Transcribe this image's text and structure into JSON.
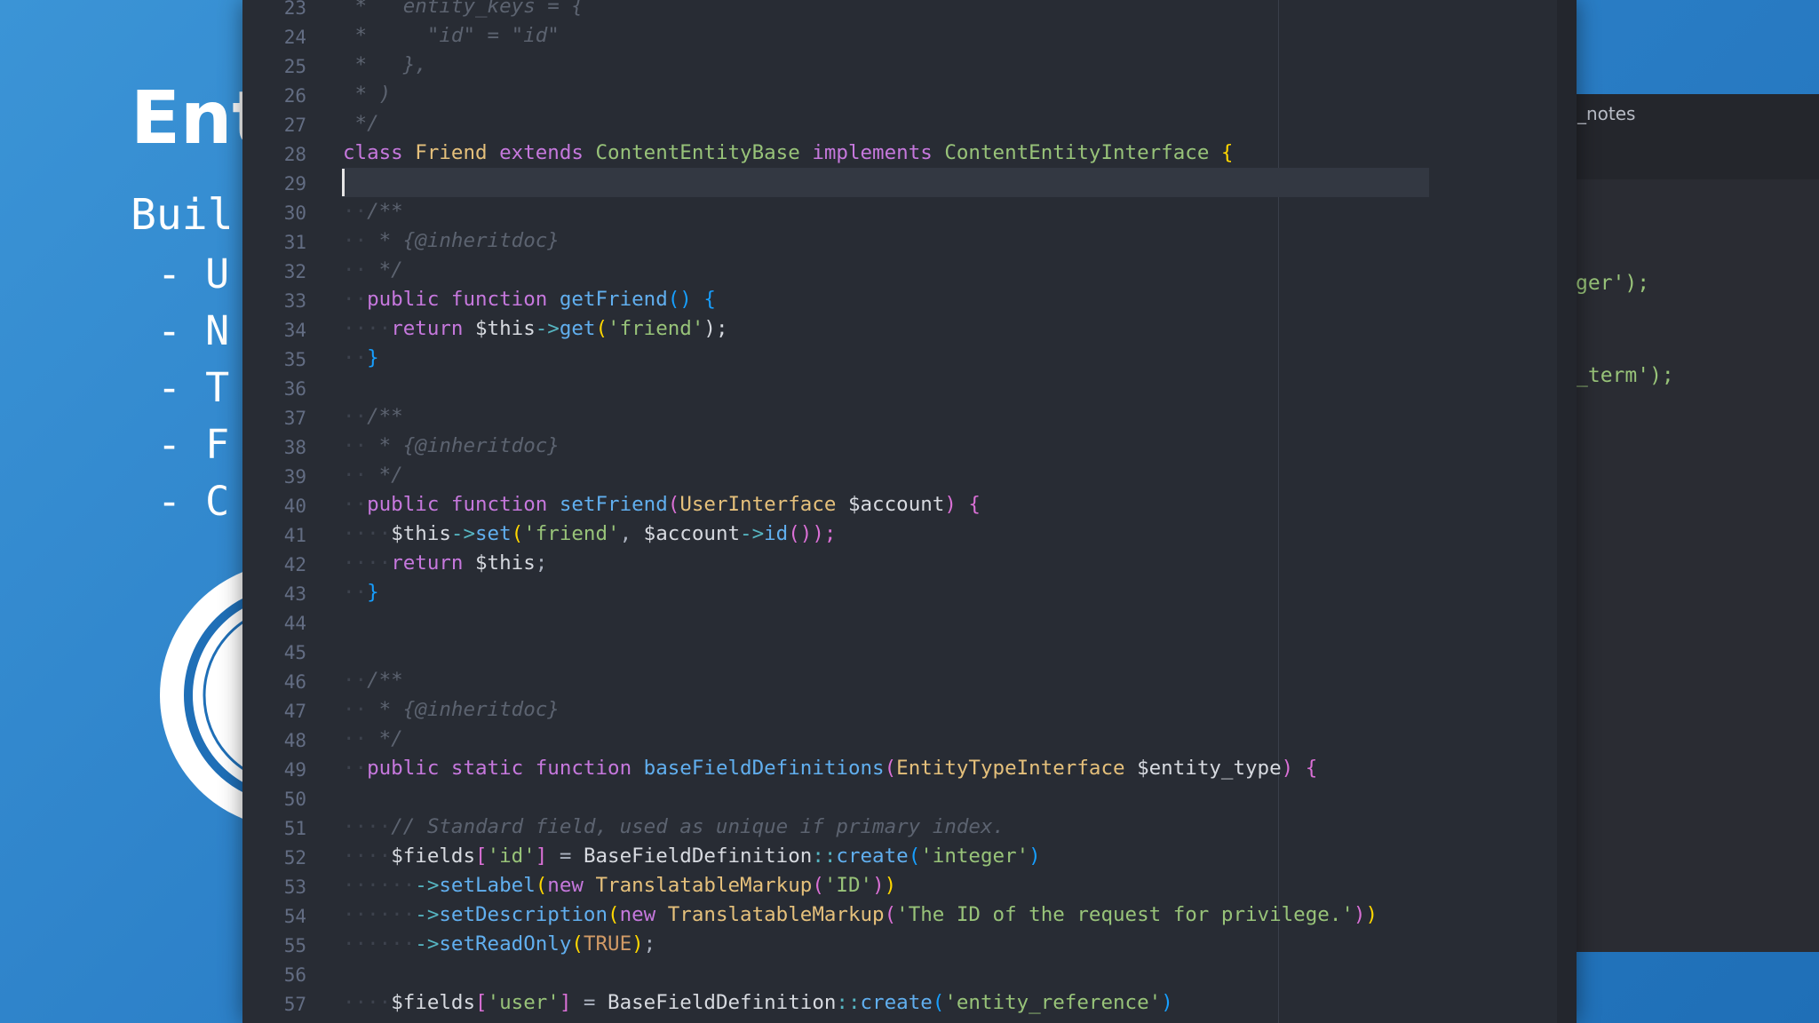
{
  "slide": {
    "title": "Ent",
    "subtitle": "Buil",
    "bullets": [
      "- U",
      "- N",
      "- T",
      "- F",
      "- C"
    ]
  },
  "right_window": {
    "tab_label": "_notes",
    "code_lines": [
      "ger');",
      "_term');"
    ]
  },
  "editor": {
    "line_numbers": [
      "23",
      "24",
      "25",
      "26",
      "27",
      "28",
      "29",
      "30",
      "31",
      "32",
      "33",
      "34",
      "35",
      "36",
      "37",
      "38",
      "39",
      "40",
      "41",
      "42",
      "43",
      "44",
      "45",
      "46",
      "47",
      "48",
      "49",
      "50",
      "51",
      "52",
      "53",
      "54",
      "55",
      "56",
      "57"
    ],
    "lines": {
      "l23": " *   entity_keys = {",
      "l24": " *     \"id\" = \"id\"",
      "l25": " *   },",
      "l26": " * )",
      "l27": " */",
      "l28": {
        "class_kw": "class",
        "name": "Friend",
        "extends_kw": "extends",
        "base": "ContentEntityBase",
        "implements_kw": "implements",
        "iface": "ContentEntityInterface",
        "brace": "{"
      },
      "l30": "/**",
      "l31": "* {@inheritdoc}",
      "l32": "*/",
      "l33": {
        "mod": "public",
        "fn": "function",
        "name": "getFriend",
        "rest": "() {"
      },
      "l34": {
        "ret": "return",
        "this": "$this",
        "arrow": "->",
        "method": "get",
        "arg": "'friend'",
        "end": ");"
      },
      "l35": "}",
      "l37": "/**",
      "l38": "* {@inheritdoc}",
      "l39": "*/",
      "l40": {
        "mod": "public",
        "fn": "function",
        "name": "setFriend",
        "type": "UserInterface",
        "var": "$account",
        "end": ") {"
      },
      "l41": {
        "this": "$this",
        "arrow": "->",
        "method": "set",
        "arg": "'friend'",
        "var": "$account",
        "arrow2": "->",
        "method2": "id",
        "end": "());"
      },
      "l42": {
        "ret": "return",
        "this": "$this",
        "end": ";"
      },
      "l43": "}",
      "l46": "/**",
      "l47": "* {@inheritdoc}",
      "l48": "*/",
      "l49": {
        "mod": "public",
        "st": "static",
        "fn": "function",
        "name": "baseFieldDefinitions",
        "type": "EntityTypeInterface",
        "var": "$entity_type",
        "end": ") {"
      },
      "l51": "// Standard field, used as unique if primary index.",
      "l52": {
        "var": "$fields",
        "key": "'id'",
        "cls": "BaseFieldDefinition",
        "sep": "::",
        "method": "create",
        "arg": "'integer'"
      },
      "l53": {
        "arrow": "->",
        "method": "setLabel",
        "new": "new",
        "cls": "TranslatableMarkup",
        "arg": "'ID'"
      },
      "l54": {
        "arrow": "->",
        "method": "setDescription",
        "new": "new",
        "cls": "TranslatableMarkup",
        "arg": "'The ID of the request for privilege.'"
      },
      "l55": {
        "arrow": "->",
        "method": "setReadOnly",
        "arg": "TRUE"
      },
      "l57": {
        "var": "$fields",
        "key": "'user'",
        "cls": "BaseFieldDefinition",
        "sep": "::",
        "method": "create",
        "arg": "'entity_reference'"
      }
    }
  },
  "colors": {
    "editor_bg": "#282c34",
    "keyword": "#c678dd",
    "class_name": "#e5c07b",
    "function": "#61afef",
    "string": "#98c379",
    "comment": "#5c6370",
    "slide_bg": "#2d7fc6"
  }
}
